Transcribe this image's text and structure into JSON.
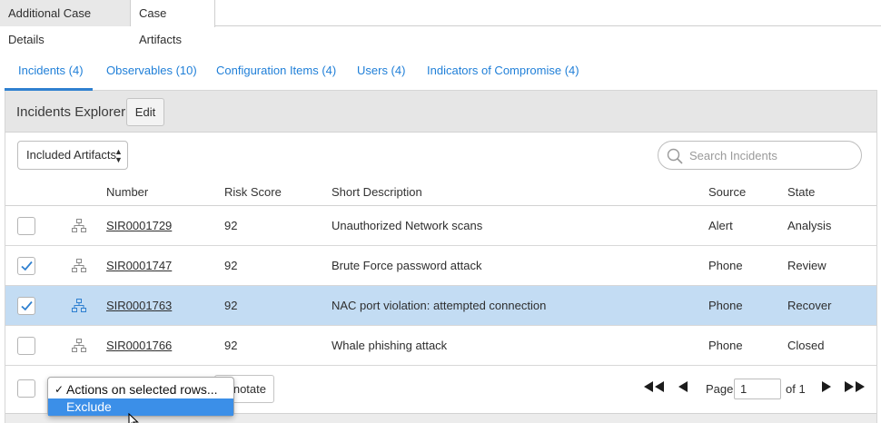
{
  "top_tabs": [
    "Additional Case Details",
    "Case Artifacts"
  ],
  "related_tabs": [
    {
      "label": "Incidents (4)",
      "active": true
    },
    {
      "label": "Observables (10)",
      "active": false
    },
    {
      "label": "Configuration Items (4)",
      "active": false
    },
    {
      "label": "Users (4)",
      "active": false
    },
    {
      "label": "Indicators of Compromise (4)",
      "active": false
    }
  ],
  "panel": {
    "title": "Incidents Explorer",
    "edit_label": "Edit",
    "filter_value": "Included Artifacts",
    "search_placeholder": "Search Incidents"
  },
  "columns": [
    "Number",
    "Risk Score",
    "Short Description",
    "Source",
    "State"
  ],
  "rows": [
    {
      "checked": false,
      "selected": false,
      "number": "SIR0001729",
      "risk": "92",
      "desc": "Unauthorized Network scans",
      "source": "Alert",
      "state": "Analysis"
    },
    {
      "checked": true,
      "selected": false,
      "number": "SIR0001747",
      "risk": "92",
      "desc": "Brute Force password attack",
      "source": "Phone",
      "state": "Review"
    },
    {
      "checked": true,
      "selected": true,
      "number": "SIR0001763",
      "risk": "92",
      "desc": "NAC port violation: attempted connection",
      "source": "Phone",
      "state": "Recover"
    },
    {
      "checked": false,
      "selected": false,
      "number": "SIR0001766",
      "risk": "92",
      "desc": "Whale phishing attack",
      "source": "Phone",
      "state": "Closed"
    }
  ],
  "footer": {
    "actions_menu": [
      "Actions on selected rows...",
      "Exclude"
    ],
    "annotate_label": "notate",
    "page_label": "Page",
    "page_value": "1",
    "of_label": "of 1"
  },
  "colors": {
    "link_blue": "#1f7fd8",
    "selected_row": "#c3dcf3",
    "menu_highlight": "#3b8fe8"
  }
}
